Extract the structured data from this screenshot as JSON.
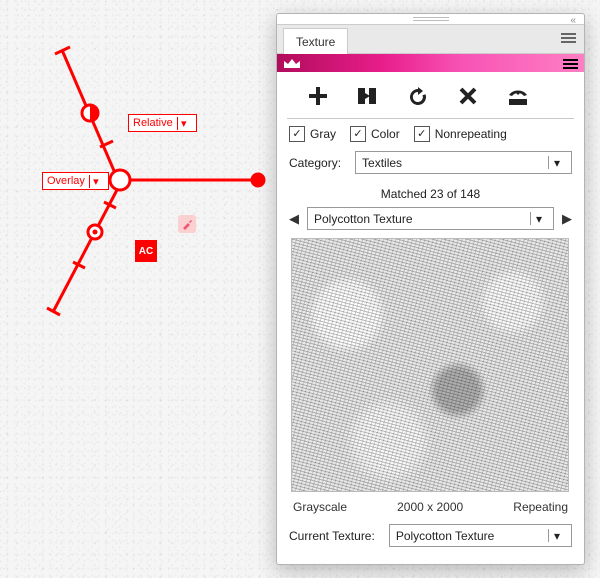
{
  "canvas": {
    "overlay_label": "Overlay",
    "relative_label": "Relative",
    "ac_badge": "AC"
  },
  "panel": {
    "tab_label": "Texture",
    "checkboxes": {
      "gray": "Gray",
      "color": "Color",
      "nonrepeating": "Nonrepeating"
    },
    "category_label": "Category:",
    "category_value": "Textiles",
    "matched_text": "Matched 23 of 148",
    "selected_texture": "Polycotton Texture",
    "info": {
      "mode": "Grayscale",
      "dims": "2000 x 2000",
      "repeat": "Repeating"
    },
    "current_label": "Current Texture:",
    "current_value": "Polycotton Texture"
  }
}
